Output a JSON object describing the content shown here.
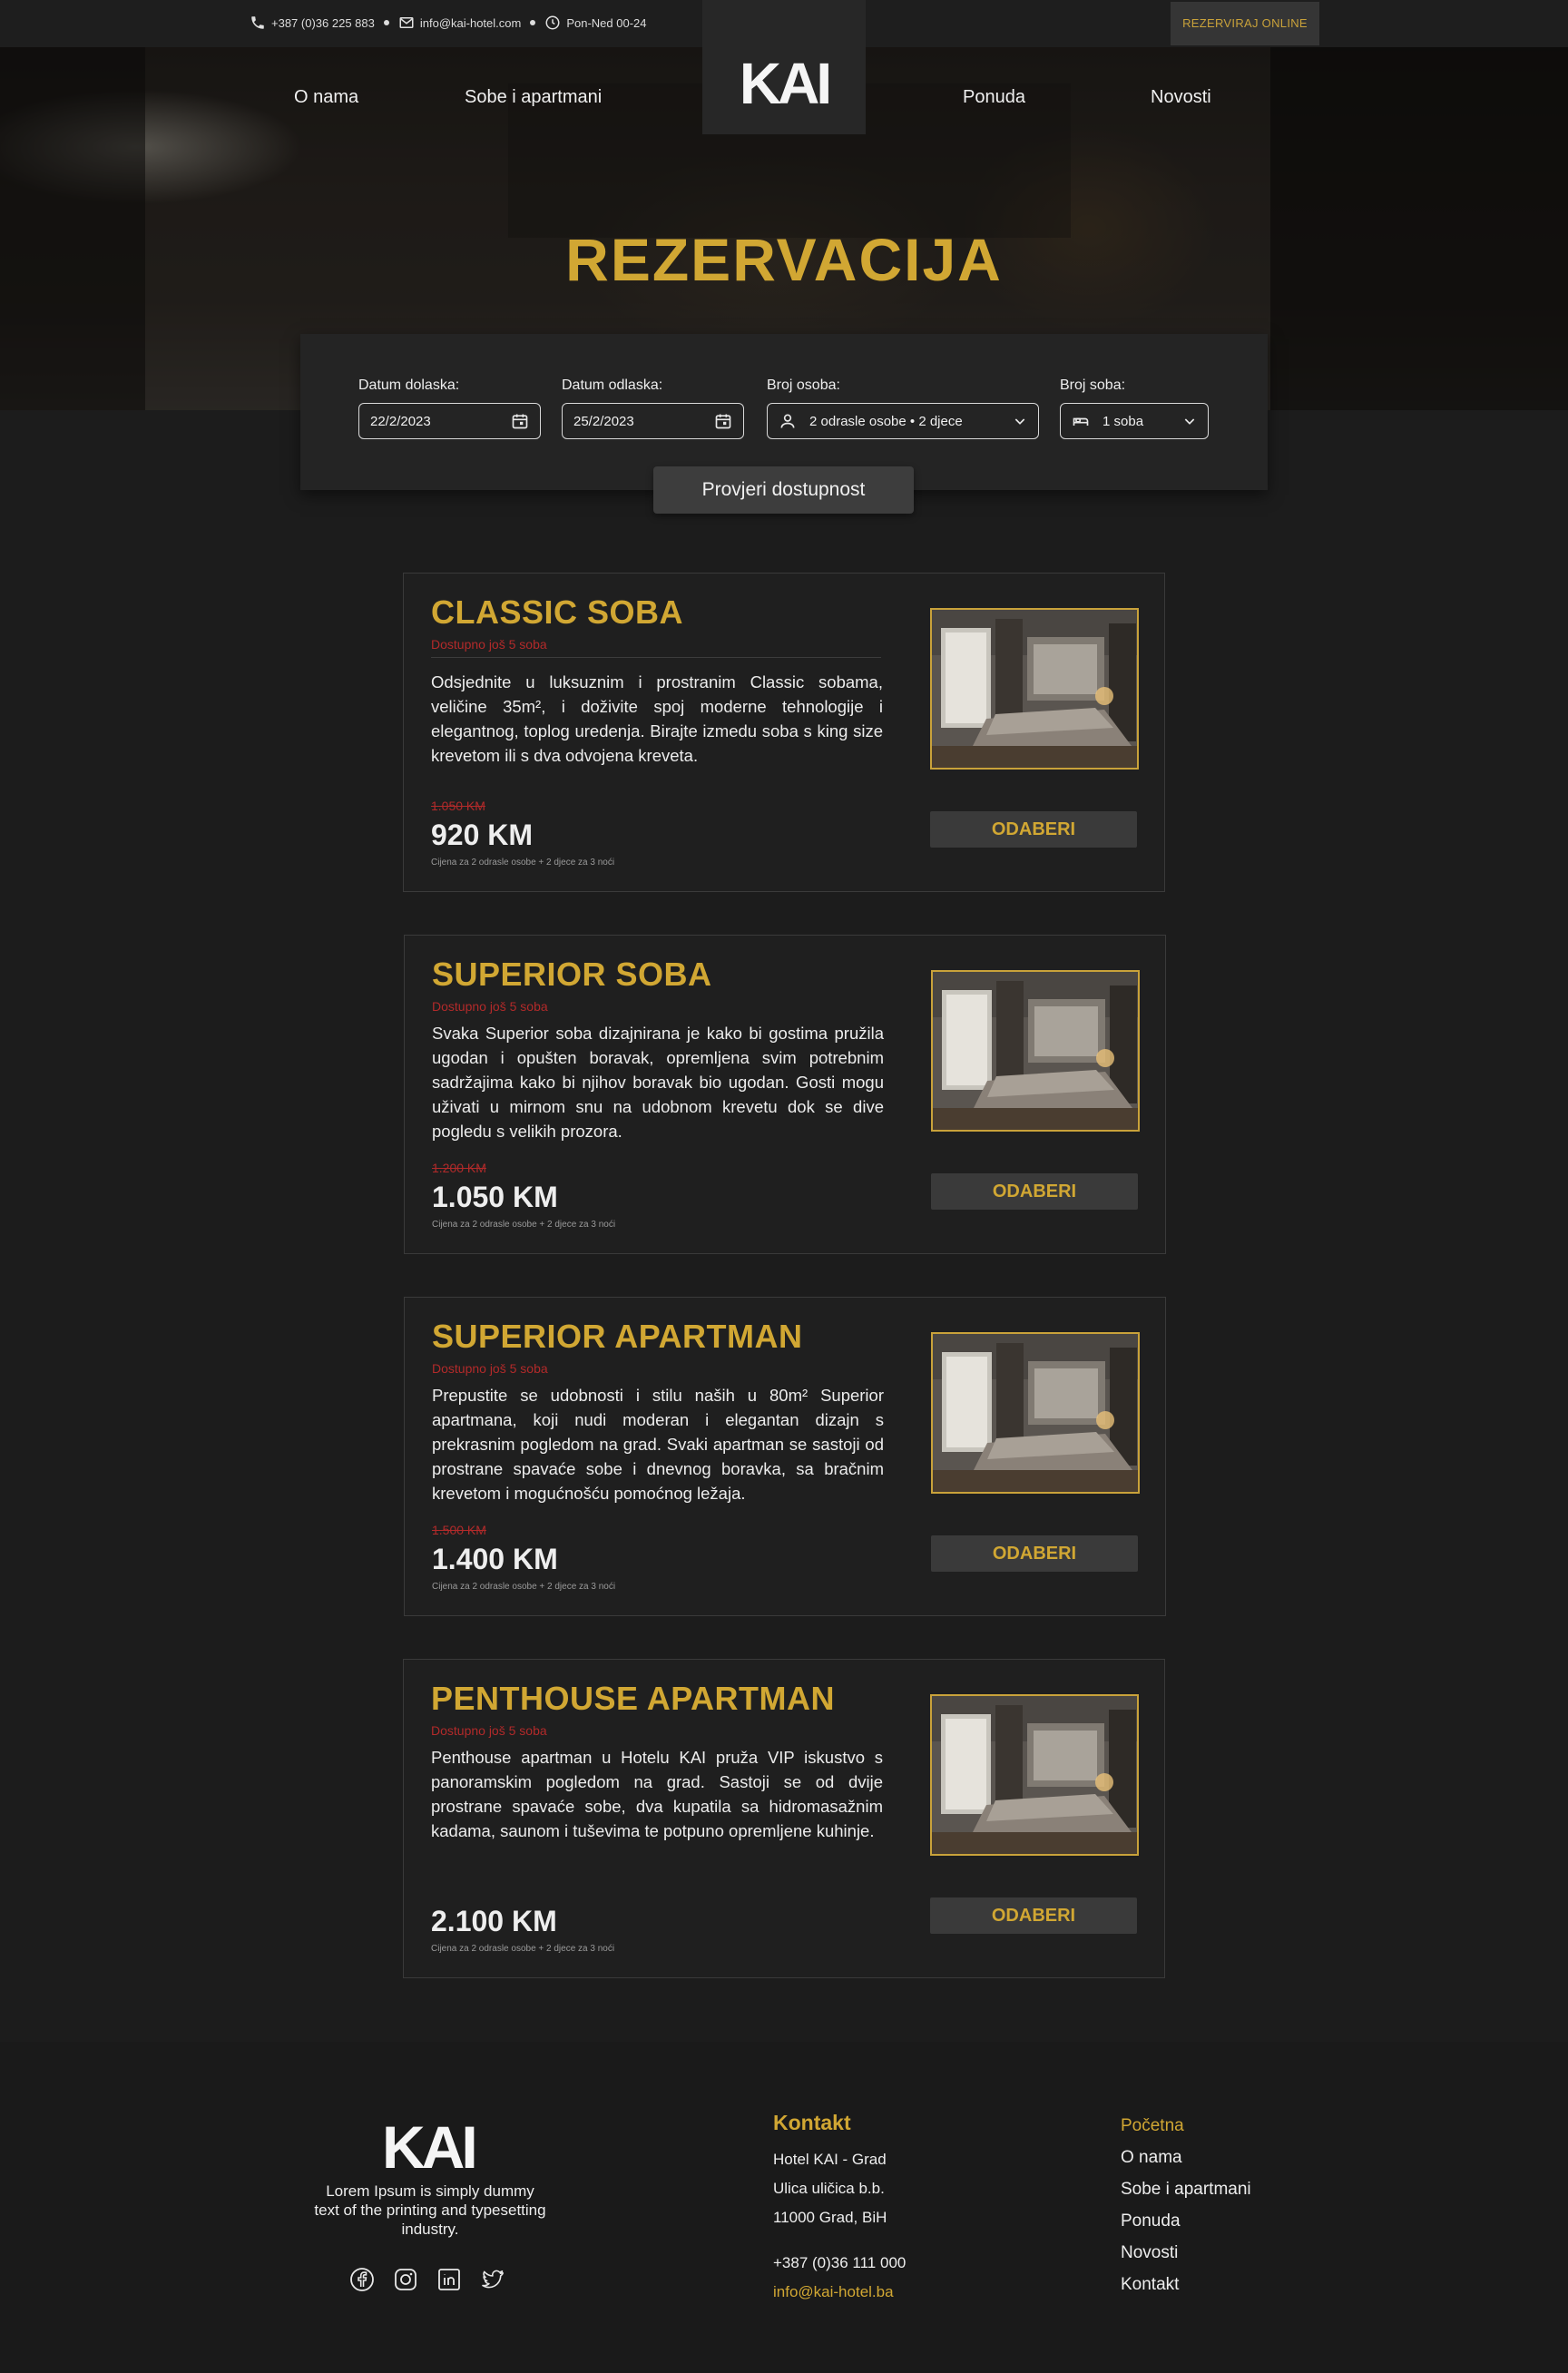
{
  "topbar": {
    "phone": "+387 (0)36 225 883",
    "email": "info@kai-hotel.com",
    "hours": "Pon-Ned 00-24",
    "book_online": "REZERVIRAJ ONLINE"
  },
  "nav": {
    "about": "O nama",
    "rooms": "Sobe i apartmani",
    "logo": "KAI",
    "offer": "Ponuda",
    "news": "Novosti"
  },
  "hero": {
    "title": "REZERVACIJA"
  },
  "booking": {
    "arrival_label": "Datum dolaska:",
    "arrival_value": "22/2/2023",
    "departure_label": "Datum odlaska:",
    "departure_value": "25/2/2023",
    "guests_label": "Broj osoba:",
    "guests_value": "2 odrasle osobe • 2 djece",
    "rooms_label": "Broj soba:",
    "rooms_value": "1 soba",
    "check_button": "Provjeri dostupnost"
  },
  "rooms": [
    {
      "title": "CLASSIC SOBA",
      "availability": "Dostupno još 5 soba",
      "description": "Odsjednite u luksuznim i prostranim Classic sobama, veličine 35m², i doživite spoj moderne tehnologije i elegantnog, toplog uredenja. Birajte izmedu soba s king size krevetom ili s dva odvojena kreveta.",
      "old_price": "1.050 KM",
      "price": "920 KM",
      "note": "Cijena za 2 odrasle osobe + 2 djece za 3 noći",
      "button": "ODABERI"
    },
    {
      "title": "SUPERIOR SOBA",
      "availability": "Dostupno još 5 soba",
      "description": "Svaka Superior soba dizajnirana je kako bi gostima pružila ugodan i opušten boravak, opremljena svim potrebnim sadržajima kako bi njihov boravak bio ugodan. Gosti mogu uživati u mirnom snu na udobnom krevetu dok se dive pogledu s velikih prozora.",
      "old_price": "1.200 KM",
      "price": "1.050 KM",
      "note": "Cijena za 2 odrasle osobe + 2 djece za 3 noći",
      "button": "ODABERI"
    },
    {
      "title": "SUPERIOR APARTMAN",
      "availability": "Dostupno još 5 soba",
      "description": "Prepustite se udobnosti i stilu naših u 80m² Superior apartmana, koji nudi moderan i elegantan dizajn s prekrasnim pogledom na grad. Svaki apartman se sastoji od prostrane spavaće sobe i dnevnog boravka, sa bračnim krevetom i mogućnošću pomoćnog ležaja.",
      "old_price": "1.500 KM",
      "price": "1.400 KM",
      "note": "Cijena za 2 odrasle osobe + 2 djece za 3 noći",
      "button": "ODABERI"
    },
    {
      "title": "PENTHOUSE APARTMAN",
      "availability": "Dostupno još 5 soba",
      "description": "Penthouse apartman u Hotelu KAI pruža VIP iskustvo s panoramskim pogledom na grad. Sastoji se od dvije prostrane spavaće sobe, dva kupatila sa hidromasažnim kadama, saunom i tuševima te potpuno opremljene kuhinje.",
      "old_price": "",
      "price": "2.100 KM",
      "note": "Cijena za 2 odrasle osobe + 2 djece za 3 noći",
      "button": "ODABERI"
    }
  ],
  "footer": {
    "logo": "KAI",
    "lorem": "Lorem Ipsum is simply dummy text of the printing and typesetting industry.",
    "social_icons": [
      "facebook-icon",
      "instagram-icon",
      "linkedin-icon",
      "twitter-icon"
    ],
    "contact_title": "Kontakt",
    "address_1": "Hotel KAI - Grad",
    "address_2": "Ulica uličica b.b.",
    "address_3": "11000 Grad, BiH",
    "phone": "+387 (0)36 111 000",
    "email": "info@kai-hotel.ba",
    "links": [
      "Početna",
      "O nama",
      "Sobe i apartmani",
      "Ponuda",
      "Novosti",
      "Kontakt"
    ]
  },
  "colors": {
    "gold": "#d1a733",
    "red": "#b22a2a",
    "background": "#1c1c1c"
  }
}
